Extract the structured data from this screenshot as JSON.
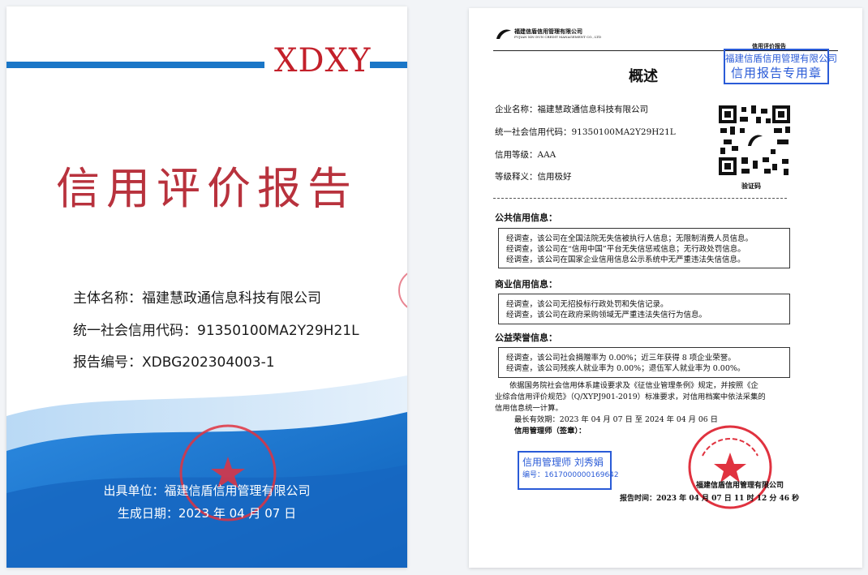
{
  "cover": {
    "brand": "XDXY",
    "title": "信用评价报告",
    "subject_label": "主体名称：",
    "subject_value": "福建慧政通信息科技有限公司",
    "credit_code_label": "统一社会信用代码：",
    "credit_code_value": "91350100MA2Y29H21L",
    "report_no_label": "报告编号：",
    "report_no_value": "XDBG202304003-1",
    "issuer_label": "出具单位：",
    "issuer_value": "福建信盾信用管理有限公司",
    "date_label": "生成日期：",
    "date_value": "2023 年 04 月 07 日",
    "seal_text": "福建信盾信用管理有限公司"
  },
  "summary": {
    "company_cn": "福建信盾信用管理有限公司",
    "company_en": "FUJIAN XIN DUN CREDIT MANAGEMENT CO., LTD",
    "doc_type": "信用评价报告",
    "stamp_line1": "福建信盾信用管理有限公司",
    "stamp_line2": "信用报告专用章",
    "heading": "概述",
    "fields": [
      {
        "label": "企业名称：",
        "value": "福建慧政通信息科技有限公司"
      },
      {
        "label": "统一社会信用代码：",
        "value": "91350100MA2Y29H21L"
      },
      {
        "label": "信用等级：",
        "value": "AAA"
      },
      {
        "label": "等级释义：",
        "value": "信用极好"
      }
    ],
    "qr_caption": "验证码",
    "sections": [
      {
        "title": "公共信用信息：",
        "lines": [
          "经调查，该公司在全国法院无失信被执行人信息；无限制消费人员信息。",
          "经调查，该公司在“信用中国”平台无失信惩戒信息；无行政处罚信息。",
          "经调查，该公司在国家企业信用信息公示系统中无严重违法失信信息。"
        ]
      },
      {
        "title": "商业信用信息：",
        "lines": [
          "经调查，该公司无招投标行政处罚和失信记录。",
          "经调查，该公司在政府采购领域无严重违法失信行为信息。"
        ]
      },
      {
        "title": "公益荣誉信息：",
        "lines": [
          "经调查，该公司社会捐赠率为 0.00%；近三年获得 8 项企业荣誉。",
          "经调查，该公司残疾人就业率为 0.00%；退伍军人就业率为 0.00%。"
        ]
      }
    ],
    "basis_lines": [
      "依据国务院社会信用体系建设要求及《征信业管理条例》规定，并按照《企",
      "业综合信用评价规范》（Q/XYPJ901-2019）标准要求，对信用档案中依法采集的",
      "信用信息统一计算。"
    ],
    "validity": "最长有效期：2023 年 04 月 07 日 至 2024 年 04 月 06 日",
    "manager_label": "信用管理师（签章）：",
    "manager_stamp_line1": "信用管理师  刘秀娟",
    "manager_stamp_line2": "编号：1617000000169642",
    "footer_company": "福建信盾信用管理有限公司",
    "report_time": "报告时间：2023 年 04 月 07 日 11 时 12 分 46 秒"
  }
}
